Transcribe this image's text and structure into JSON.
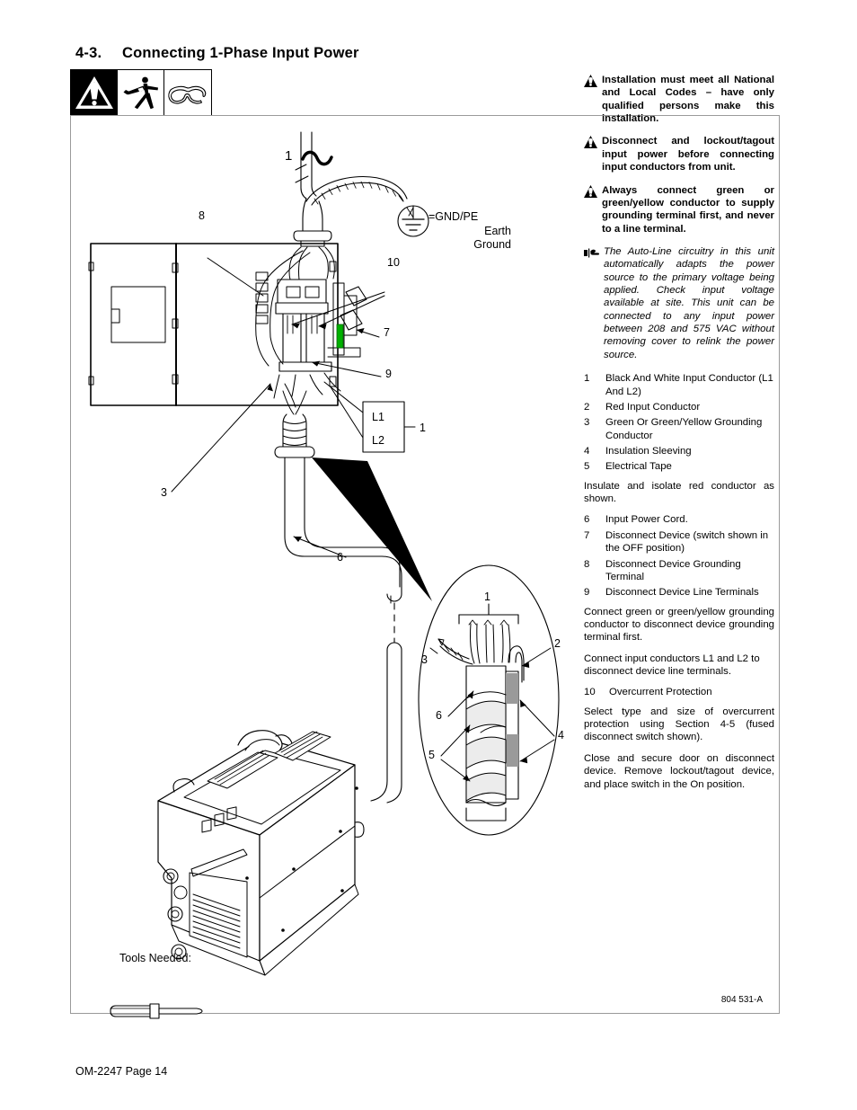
{
  "header": {
    "section_number": "4-3.",
    "title": "Connecting 1-Phase Input Power"
  },
  "safety_icons": [
    {
      "name": "warning-triangle-icon",
      "label": "Warning"
    },
    {
      "name": "electric-shock-icon",
      "label": "Electric Shock Hazard"
    },
    {
      "name": "safety-glasses-icon",
      "label": "Wear Safety Glasses"
    }
  ],
  "warnings": [
    "Installation must meet all National and Local Codes – have only qualified persons make this installation.",
    "Disconnect and lockout/tagout input power before connecting input conductors from unit.",
    "Always connect green or green/yellow conductor to supply grounding terminal first, and never to a line  terminal."
  ],
  "note": "The Auto-Line circuitry in this unit automatically adapts the power source to the primary voltage being applied. Check input voltage available at site. This unit can be connected to any input power between 208 and 575 VAC without removing cover  to relink the power source.",
  "items": [
    {
      "num": "1",
      "text": "Black And White Input Conductor (L1 And L2)"
    },
    {
      "num": "2",
      "text": "Red Input Conductor"
    },
    {
      "num": "3",
      "text": "Green Or Green/Yellow Grounding Conductor"
    },
    {
      "num": "4",
      "text": "Insulation Sleeving"
    },
    {
      "num": "5",
      "text": "Electrical Tape"
    }
  ],
  "para_insulate": "Insulate and isolate red conductor as shown.",
  "items2": [
    {
      "num": "6",
      "text": "Input Power Cord."
    },
    {
      "num": "7",
      "text": "Disconnect Device (switch shown in the OFF position)"
    },
    {
      "num": "8",
      "text": "Disconnect Device Grounding Terminal"
    },
    {
      "num": "9",
      "text": "Disconnect Device Line Terminals"
    }
  ],
  "para_ground": "Connect green or green/yellow grounding conductor to disconnect device grounding terminal first.",
  "para_line": "Connect input conductors L1 and L2 to disconnect device line terminals.",
  "item10": {
    "num": "10",
    "text": "Overcurrent Protection"
  },
  "para_overcurrent": "Select type and size of overcurrent protection using Section 4-5 (fused disconnect switch shown).",
  "para_close": "Close and secure door on disconnect device. Remove lockout/tagout device, and place switch in the On position.",
  "diagram": {
    "phase_label": "1",
    "ground_symbol_text": [
      "=GND/PE",
      "Earth",
      "Ground"
    ],
    "terminal_l1": "L1",
    "terminal_l2": "L2",
    "terminal_bracket_label": "1",
    "callouts_main": [
      {
        "id": "8",
        "value": "8"
      },
      {
        "id": "10",
        "value": "10"
      },
      {
        "id": "7",
        "value": "7"
      },
      {
        "id": "9",
        "value": "9"
      },
      {
        "id": "3",
        "value": "3"
      },
      {
        "id": "6",
        "value": "6"
      }
    ],
    "callouts_detail": [
      {
        "id": "d1",
        "value": "1"
      },
      {
        "id": "d2",
        "value": "2"
      },
      {
        "id": "d3",
        "value": "3"
      },
      {
        "id": "d4",
        "value": "4"
      },
      {
        "id": "d5",
        "value": "5"
      },
      {
        "id": "d6",
        "value": "6"
      }
    ],
    "switch_handle_color": "#00b000"
  },
  "tools": {
    "label": "Tools Needed:",
    "icon": "flat-screwdriver-icon"
  },
  "drawing_number": "804 531-A",
  "footer": "OM-2247 Page 14"
}
